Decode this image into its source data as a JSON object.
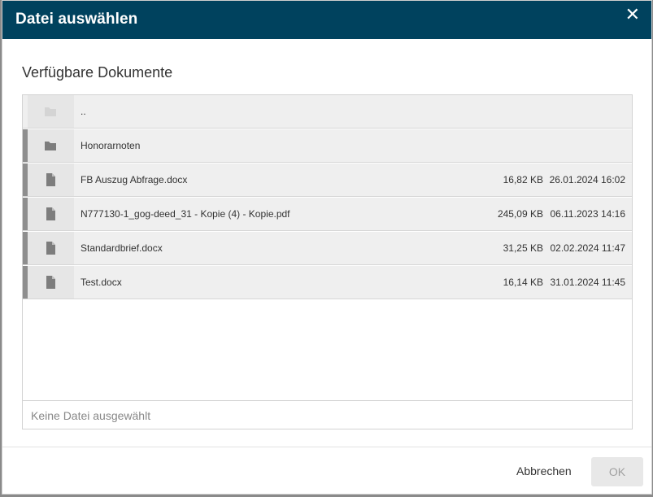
{
  "dialog": {
    "title": "Datei auswählen",
    "close_icon": "close-icon"
  },
  "section_title": "Verfügbare Dokumente",
  "files": [
    {
      "name": "..",
      "type": "folder",
      "size": "",
      "date": ""
    },
    {
      "name": "Honorarnoten",
      "type": "folder",
      "size": "",
      "date": ""
    },
    {
      "name": "FB Auszug Abfrage.docx",
      "type": "file",
      "size": "16,82 KB",
      "date": "26.01.2024 16:02"
    },
    {
      "name": "N777130-1_gog-deed_31 - Kopie (4) - Kopie.pdf",
      "type": "file",
      "size": "245,09 KB",
      "date": "06.11.2023 14:16"
    },
    {
      "name": "Standardbrief.docx",
      "type": "file",
      "size": "31,25 KB",
      "date": "02.02.2024 11:47"
    },
    {
      "name": "Test.docx",
      "type": "file",
      "size": "16,14 KB",
      "date": "31.01.2024 11:45"
    }
  ],
  "selection": {
    "placeholder": "Keine Datei ausgewählt"
  },
  "buttons": {
    "cancel": "Abbrechen",
    "ok": "OK"
  },
  "colors": {
    "header_bg": "#00425e",
    "row_bg": "#efefef",
    "accent_bar": "#8e8e8e"
  }
}
